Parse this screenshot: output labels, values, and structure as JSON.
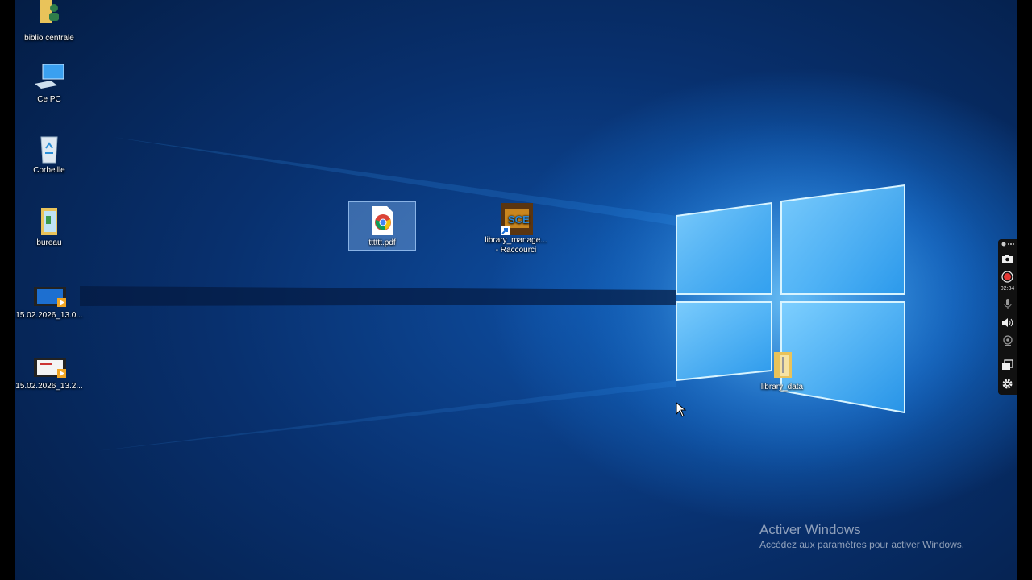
{
  "desktop_icons": [
    {
      "label": "biblio centrale",
      "icon": "user-folder-icon"
    },
    {
      "label": "Ce PC",
      "icon": "computer-icon"
    },
    {
      "label": "Corbeille",
      "icon": "recycle-bin-icon"
    },
    {
      "label": "bureau",
      "icon": "folder-icon"
    },
    {
      "label": "15.02.2026_13.0...",
      "icon": "video-file-icon"
    },
    {
      "label": "15.02.2026_13.2...",
      "icon": "video-file-icon"
    },
    {
      "label": "tttttt.pdf",
      "icon": "chrome-pdf-icon"
    },
    {
      "label": "library_manage... - Raccourci",
      "icon": "app-shortcut-icon"
    },
    {
      "label": "library_data",
      "icon": "folder-icon"
    }
  ],
  "watermark": {
    "title": "Activer Windows",
    "subtitle": "Accédez aux paramètres pour activer Windows."
  },
  "recorder": {
    "timer": "02:34",
    "buttons": [
      "pin-icon",
      "camera-icon",
      "record-icon",
      "microphone-icon",
      "speaker-icon",
      "webcam-icon",
      "screen-icon",
      "settings-icon"
    ]
  },
  "colors": {
    "accent": "#1a7fe0",
    "record": "#e53935"
  }
}
